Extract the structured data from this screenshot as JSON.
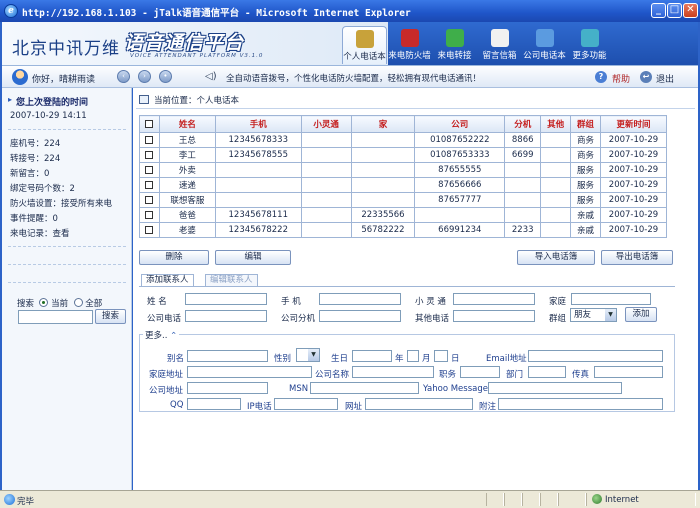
{
  "window": {
    "title": "http://192.168.1.103 - jTalk语音通信平台 - Microsoft Internet Explorer",
    "min": "_",
    "max": "□",
    "close": "✕"
  },
  "header": {
    "brand": "北京中讯万维",
    "product": "语音通信平台",
    "product_sub": "VOICE ATTENDANT PLATFORM V3.1.0",
    "tabs": [
      {
        "label": "个人电话本",
        "icon": "phonebook-icon",
        "color": "#c8a23a"
      },
      {
        "label": "来电防火墙",
        "icon": "firewall-icon",
        "color": "#c82a2a"
      },
      {
        "label": "来电转接",
        "icon": "transfer-icon",
        "color": "#3fae4a"
      },
      {
        "label": "留言信箱",
        "icon": "mailbox-icon",
        "color": "#f1f1f1"
      },
      {
        "label": "公司电话本",
        "icon": "company-phonebook-icon",
        "color": "#5b9be0"
      },
      {
        "label": "更多功能",
        "icon": "more-icon",
        "color": "#45b0c8"
      }
    ]
  },
  "toolbar": {
    "greeting": "你好，晴耕雨读",
    "marquee": "全自动语音拨号，个性化电话防火墙配置，轻松拥有现代电话通讯！",
    "help": "帮助",
    "exit": "退出"
  },
  "sidebar": {
    "last_login_title": "您上次登陆的时间",
    "last_login_time": "2007-10-29 14:11",
    "info": [
      "座机号：224",
      "转接号：224",
      "新留言：0",
      "绑定号码个数：2",
      "防火墙设置：接受所有来电",
      "事件提醒：0",
      "来电记录：查看"
    ],
    "search_label": "搜索",
    "opt_current": "当前",
    "opt_all": "全部",
    "search_button": "搜索"
  },
  "main": {
    "breadcrumb": "当前位置：个人电话本",
    "columns": [
      "姓名",
      "手机",
      "小灵通",
      "家",
      "公司",
      "分机",
      "其他",
      "群组",
      "更新时间"
    ],
    "rows": [
      [
        "王总",
        "12345678333",
        "",
        "",
        "01087652222",
        "8866",
        "",
        "商务",
        "2007-10-29"
      ],
      [
        "李工",
        "12345678555",
        "",
        "",
        "01087653333",
        "6699",
        "",
        "商务",
        "2007-10-29"
      ],
      [
        "外卖",
        "",
        "",
        "",
        "87655555",
        "",
        "",
        "服务",
        "2007-10-29"
      ],
      [
        "速递",
        "",
        "",
        "",
        "87656666",
        "",
        "",
        "服务",
        "2007-10-29"
      ],
      [
        "联想客服",
        "",
        "",
        "",
        "87657777",
        "",
        "",
        "服务",
        "2007-10-29"
      ],
      [
        "爸爸",
        "12345678111",
        "",
        "22335566",
        "",
        "",
        "",
        "亲戚",
        "2007-10-29"
      ],
      [
        "老婆",
        "12345678222",
        "",
        "56782222",
        "66991234",
        "2233",
        "",
        "亲戚",
        "2007-10-29"
      ]
    ],
    "buttons": {
      "delete": "删除",
      "edit": "编辑",
      "import": "导入电话簿",
      "export": "导出电话簿"
    },
    "tabs": {
      "add": "添加联系人",
      "edit": "编辑联系人"
    },
    "form": {
      "name": "姓    名",
      "mobile": "手    机",
      "pas": "小 灵 通",
      "home": "家庭",
      "company_phone": "公司电话",
      "ext": "公司分机",
      "other_phone": "其他电话",
      "group": "群组",
      "group_value": "朋友",
      "add_button": "添加"
    },
    "more": {
      "label": "更多..",
      "nickname": "别名",
      "gender": "性别",
      "birthday": "生日",
      "year": "年",
      "month": "月",
      "day": "日",
      "email": "Email地址",
      "home_addr": "家庭地址",
      "company_name": "公司名称",
      "title": "职务",
      "dept": "部门",
      "fax": "传真",
      "company_addr": "公司地址",
      "msn": "MSN",
      "yahoo": "Yahoo Messager",
      "qq": "QQ",
      "ip_phone": "IP电话",
      "website": "网址",
      "note": "附注"
    }
  },
  "statusbar": {
    "status": "完毕",
    "zone": "Internet"
  }
}
